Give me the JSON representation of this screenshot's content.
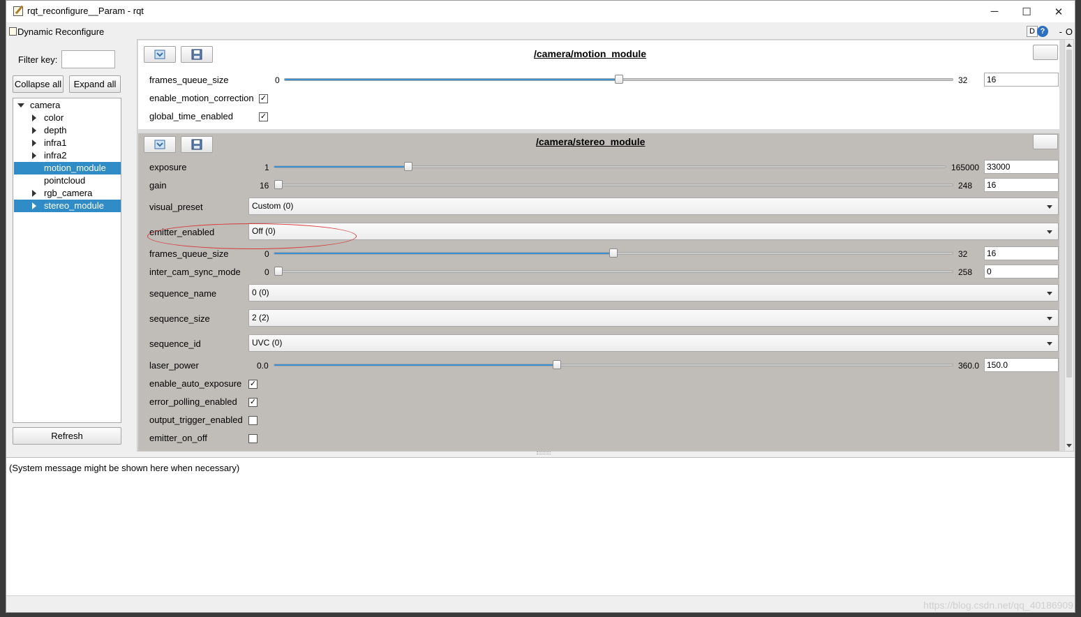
{
  "window": {
    "title": "rqt_reconfigure__Param - rqt",
    "minimize": "─",
    "maximize": "☐",
    "close": "✕"
  },
  "menubar": {
    "title": "Dynamic Reconfigure",
    "d_label": "D",
    "help_label": "?",
    "minus_label": "-",
    "o_label": "O"
  },
  "left": {
    "filter_label": "Filter key:",
    "filter_value": "",
    "collapse_label": "Collapse all",
    "expand_label": "Expand all",
    "refresh_label": "Refresh",
    "tree": [
      {
        "label": "camera",
        "arrow": "down",
        "level": 0,
        "selected": false
      },
      {
        "label": "color",
        "arrow": "right",
        "level": 1,
        "selected": false
      },
      {
        "label": "depth",
        "arrow": "right",
        "level": 1,
        "selected": false
      },
      {
        "label": "infra1",
        "arrow": "right",
        "level": 1,
        "selected": false
      },
      {
        "label": "infra2",
        "arrow": "right",
        "level": 1,
        "selected": false
      },
      {
        "label": "motion_module",
        "arrow": "",
        "level": 1,
        "selected": true
      },
      {
        "label": "pointcloud",
        "arrow": "",
        "level": 1,
        "selected": false
      },
      {
        "label": "rgb_camera",
        "arrow": "right",
        "level": 1,
        "selected": false
      },
      {
        "label": "stereo_module",
        "arrow": "right",
        "level": 1,
        "selected": true
      }
    ]
  },
  "motion_module": {
    "title": "/camera/motion_module",
    "frames_queue_size": {
      "label": "frames_queue_size",
      "min": "0",
      "max": "32",
      "value": "16",
      "fraction": 0.5
    },
    "enable_motion_correction": {
      "label": "enable_motion_correction",
      "checked": true
    },
    "global_time_enabled": {
      "label": "global_time_enabled",
      "checked": true
    }
  },
  "stereo_module": {
    "title": "/camera/stereo_module",
    "exposure": {
      "label": "exposure",
      "min": "1",
      "max": "165000",
      "value": "33000",
      "fraction": 0.2
    },
    "gain": {
      "label": "gain",
      "min": "16",
      "max": "248",
      "value": "16",
      "fraction": 0.0
    },
    "visual_preset": {
      "label": "visual_preset",
      "value": "Custom (0)"
    },
    "emitter_enabled": {
      "label": "emitter_enabled",
      "value": "Off (0)"
    },
    "frames_queue_size": {
      "label": "frames_queue_size",
      "min": "0",
      "max": "32",
      "value": "16",
      "fraction": 0.5
    },
    "inter_cam_sync_mode": {
      "label": "inter_cam_sync_mode",
      "min": "0",
      "max": "258",
      "value": "0",
      "fraction": 0.0
    },
    "sequence_name": {
      "label": "sequence_name",
      "value": "0 (0)"
    },
    "sequence_size": {
      "label": "sequence_size",
      "value": "2 (2)"
    },
    "sequence_id": {
      "label": "sequence_id",
      "value": "UVC (0)"
    },
    "laser_power": {
      "label": "laser_power",
      "min": "0.0",
      "max": "360.0",
      "value": "150.0",
      "fraction": 0.4167
    },
    "enable_auto_exposure": {
      "label": "enable_auto_exposure",
      "checked": true
    },
    "error_polling_enabled": {
      "label": "error_polling_enabled",
      "checked": true
    },
    "output_trigger_enabled": {
      "label": "output_trigger_enabled",
      "checked": false
    },
    "emitter_on_off": {
      "label": "emitter_on_off",
      "checked": false
    }
  },
  "console": {
    "message": "(System message might be shown here when necessary)"
  },
  "watermark": "https://blog.csdn.net/qq_40186909",
  "colors": {
    "selection": "#308cc6",
    "slider_fill": "#3a8fd1",
    "stereo_bg": "#c0bdb9",
    "annotation": "#d63a3a"
  }
}
